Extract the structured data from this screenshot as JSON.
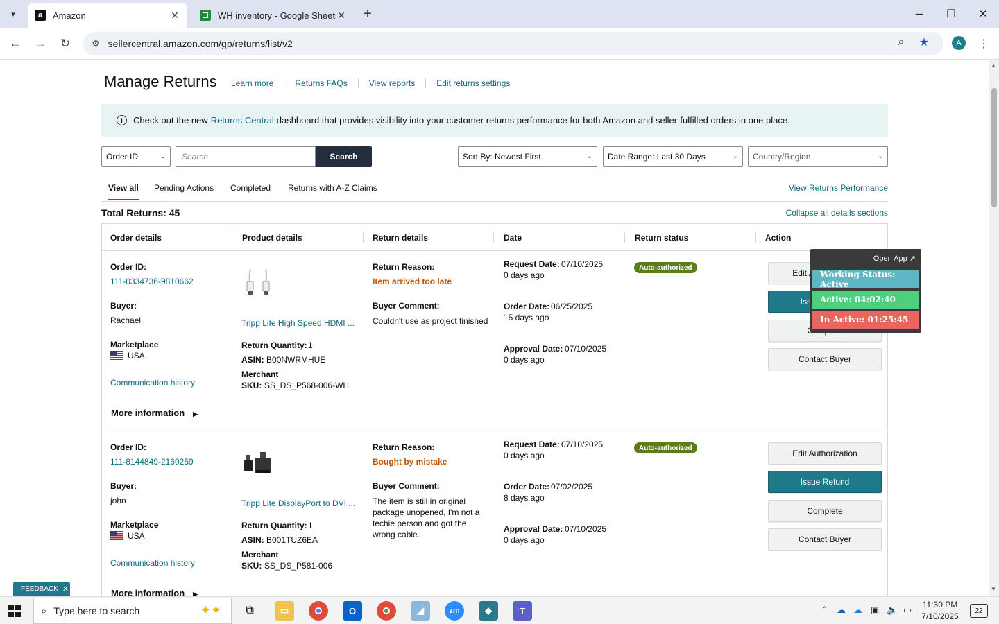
{
  "browser": {
    "tabs": [
      {
        "title": "Amazon",
        "favicon": "a"
      },
      {
        "title": "WH inventory - Google Sheets",
        "favicon": "sheets"
      }
    ],
    "url": "sellercentral.amazon.com/gp/returns/list/v2",
    "profile_initial": "A"
  },
  "page": {
    "title": "Manage Returns",
    "top_links": [
      "Learn more",
      "Returns FAQs",
      "View reports",
      "Edit returns settings"
    ],
    "banner": {
      "pre": "Check out the new",
      "link": "Returns Central",
      "post": "dashboard that provides visibility into your customer returns performance for both Amazon and seller-fulfilled orders in one place."
    },
    "filters": {
      "search_type": "Order ID",
      "search_placeholder": "Search",
      "search_button": "Search",
      "sort": "Sort By: Newest First",
      "date_range": "Date Range: Last 30 Days",
      "country": "Country/Region"
    },
    "tabs": [
      "View all",
      "Pending Actions",
      "Completed",
      "Returns with A-Z Claims"
    ],
    "view_performance": "View Returns Performance",
    "total_returns": "Total Returns: 45",
    "collapse_all": "Collapse all details sections",
    "columns": [
      "Order details",
      "Product details",
      "Return details",
      "Date",
      "Return status",
      "Action"
    ],
    "labels": {
      "order_id": "Order ID:",
      "buyer": "Buyer:",
      "marketplace": "Marketplace",
      "communication": "Communication history",
      "more_info": "More information",
      "return_qty": "Return Quantity:",
      "asin": "ASIN:",
      "merchant": "Merchant",
      "sku": "SKU:",
      "return_reason": "Return Reason:",
      "buyer_comment": "Buyer Comment:",
      "request_date": "Request Date:",
      "order_date": "Order Date:",
      "approval_date": "Approval Date:"
    },
    "actions": {
      "edit": "Edit Authorization",
      "refund": "Issue Refund",
      "complete": "Complete",
      "contact": "Contact Buyer"
    },
    "returns": [
      {
        "order_id": "111-0334736-9810662",
        "buyer": "Rachael",
        "marketplace": "USA",
        "product_name": "Tripp Lite High Speed HDMI ...",
        "product_icon": "hdmi-cable",
        "return_qty": "1",
        "asin": "B00NWRMHUE",
        "sku": "SS_DS_P568-006-WH",
        "return_reason": "Item arrived too late",
        "buyer_comment": "Couldn't use as project finished",
        "request_date": "07/10/2025",
        "request_ago": "0 days ago",
        "order_date": "06/25/2025",
        "order_ago": "15 days ago",
        "approval_date": "07/10/2025",
        "approval_ago": "0 days ago",
        "status": "Auto-authorized"
      },
      {
        "order_id": "111-8144849-2160259",
        "buyer": "john",
        "marketplace": "USA",
        "product_name": "Tripp Lite DisplayPort to DVI ...",
        "product_icon": "dvi-adapter",
        "return_qty": "1",
        "asin": "B001TUZ6EA",
        "sku": "SS_DS_P581-006",
        "return_reason": "Bought by mistake",
        "buyer_comment": "The item is still in original package unopened, I'm not a techie person and got the wrong cable.",
        "request_date": "07/10/2025",
        "request_ago": "0 days ago",
        "order_date": "07/02/2025",
        "order_ago": "8 days ago",
        "approval_date": "07/10/2025",
        "approval_ago": "0 days ago",
        "status": "Auto-authorized"
      }
    ]
  },
  "overlay": {
    "open_app": "Open App ↗",
    "working_status": "Working Status: Active",
    "active": "Active: 04:02:40",
    "inactive": "In Active: 01:25:45",
    "colors": {
      "working": "#5fb7c6",
      "active": "#4cd07d",
      "inactive": "#e8665e"
    }
  },
  "feedback": "FEEDBACK",
  "taskbar": {
    "search_placeholder": "Type here to search",
    "time": "11:30 PM",
    "date": "7/10/2025",
    "notifications": "22"
  },
  "colors": {
    "accent": "#0e6a7e",
    "primary_button": "#1e7a8a",
    "badge": "#5a7d1a",
    "reason": "#c45500"
  }
}
